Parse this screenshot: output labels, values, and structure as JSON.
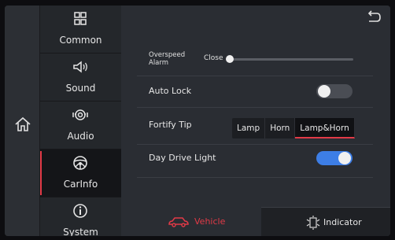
{
  "nav": {
    "items": [
      {
        "label": "Common",
        "icon": "grid-icon",
        "active": false
      },
      {
        "label": "Sound",
        "icon": "speaker-icon",
        "active": false
      },
      {
        "label": "Audio",
        "icon": "audio-icon",
        "active": false
      },
      {
        "label": "CarInfo",
        "icon": "steering-wheel-icon",
        "active": true
      },
      {
        "label": "System",
        "icon": "info-icon",
        "active": false
      }
    ]
  },
  "settings": {
    "overspeed_label": "Overspeed Alarm",
    "overspeed_value": "Close",
    "overspeed_level": 0,
    "auto_lock_label": "Auto Lock",
    "auto_lock_on": false,
    "fortify_label": "Fortify Tip",
    "fortify_options": [
      "Lamp",
      "Horn",
      "Lamp&Horn"
    ],
    "fortify_selected": "Lamp&Horn",
    "day_light_label": "Day Drive Light",
    "day_light_on": true
  },
  "tabs": {
    "vehicle": "Vehicle",
    "indicator": "Indicator"
  },
  "colors": {
    "accent": "#e23a47",
    "toggle_on": "#3d7ee6"
  }
}
